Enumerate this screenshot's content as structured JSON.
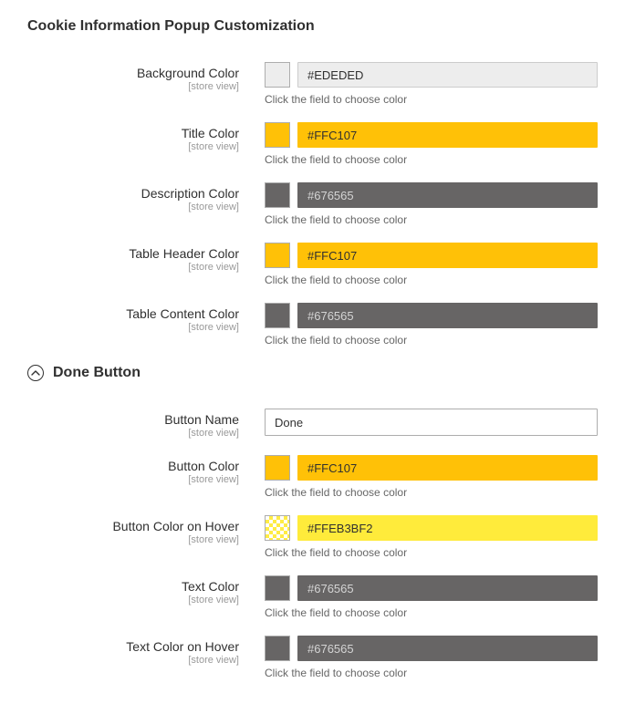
{
  "section1": {
    "title": "Cookie Information Popup Customization",
    "fields": {
      "bg": {
        "label": "Background Color",
        "scope": "[store view]",
        "value": "#EDEDED",
        "hint": "Click the field to choose color",
        "swatch": "#EDEDED",
        "cls": "light"
      },
      "title_color": {
        "label": "Title Color",
        "scope": "[store view]",
        "value": "#FFC107",
        "hint": "Click the field to choose color",
        "swatch": "#FFC107",
        "cls": "yellow"
      },
      "desc": {
        "label": "Description Color",
        "scope": "[store view]",
        "value": "#676565",
        "hint": "Click the field to choose color",
        "swatch": "#676565",
        "cls": "dark"
      },
      "th": {
        "label": "Table Header Color",
        "scope": "[store view]",
        "value": "#FFC107",
        "hint": "Click the field to choose color",
        "swatch": "#FFC107",
        "cls": "yellow"
      },
      "tc": {
        "label": "Table Content Color",
        "scope": "[store view]",
        "value": "#676565",
        "hint": "Click the field to choose color",
        "swatch": "#676565",
        "cls": "dark"
      }
    }
  },
  "section2": {
    "title": "Done Button",
    "fields": {
      "name": {
        "label": "Button Name",
        "scope": "[store view]",
        "value": "Done"
      },
      "btn": {
        "label": "Button Color",
        "scope": "[store view]",
        "value": "#FFC107",
        "hint": "Click the field to choose color",
        "swatch": "#FFC107",
        "cls": "yellow"
      },
      "btn_hover": {
        "label": "Button Color on Hover",
        "scope": "[store view]",
        "value": "#FFEB3BF2",
        "hint": "Click the field to choose color",
        "swatch": "#FFEB3B",
        "cls": "lightyellow",
        "hatched": true
      },
      "text": {
        "label": "Text Color",
        "scope": "[store view]",
        "value": "#676565",
        "hint": "Click the field to choose color",
        "swatch": "#676565",
        "cls": "dark"
      },
      "text_hover": {
        "label": "Text Color on Hover",
        "scope": "[store view]",
        "value": "#676565",
        "hint": "Click the field to choose color",
        "swatch": "#676565",
        "cls": "dark"
      }
    }
  }
}
